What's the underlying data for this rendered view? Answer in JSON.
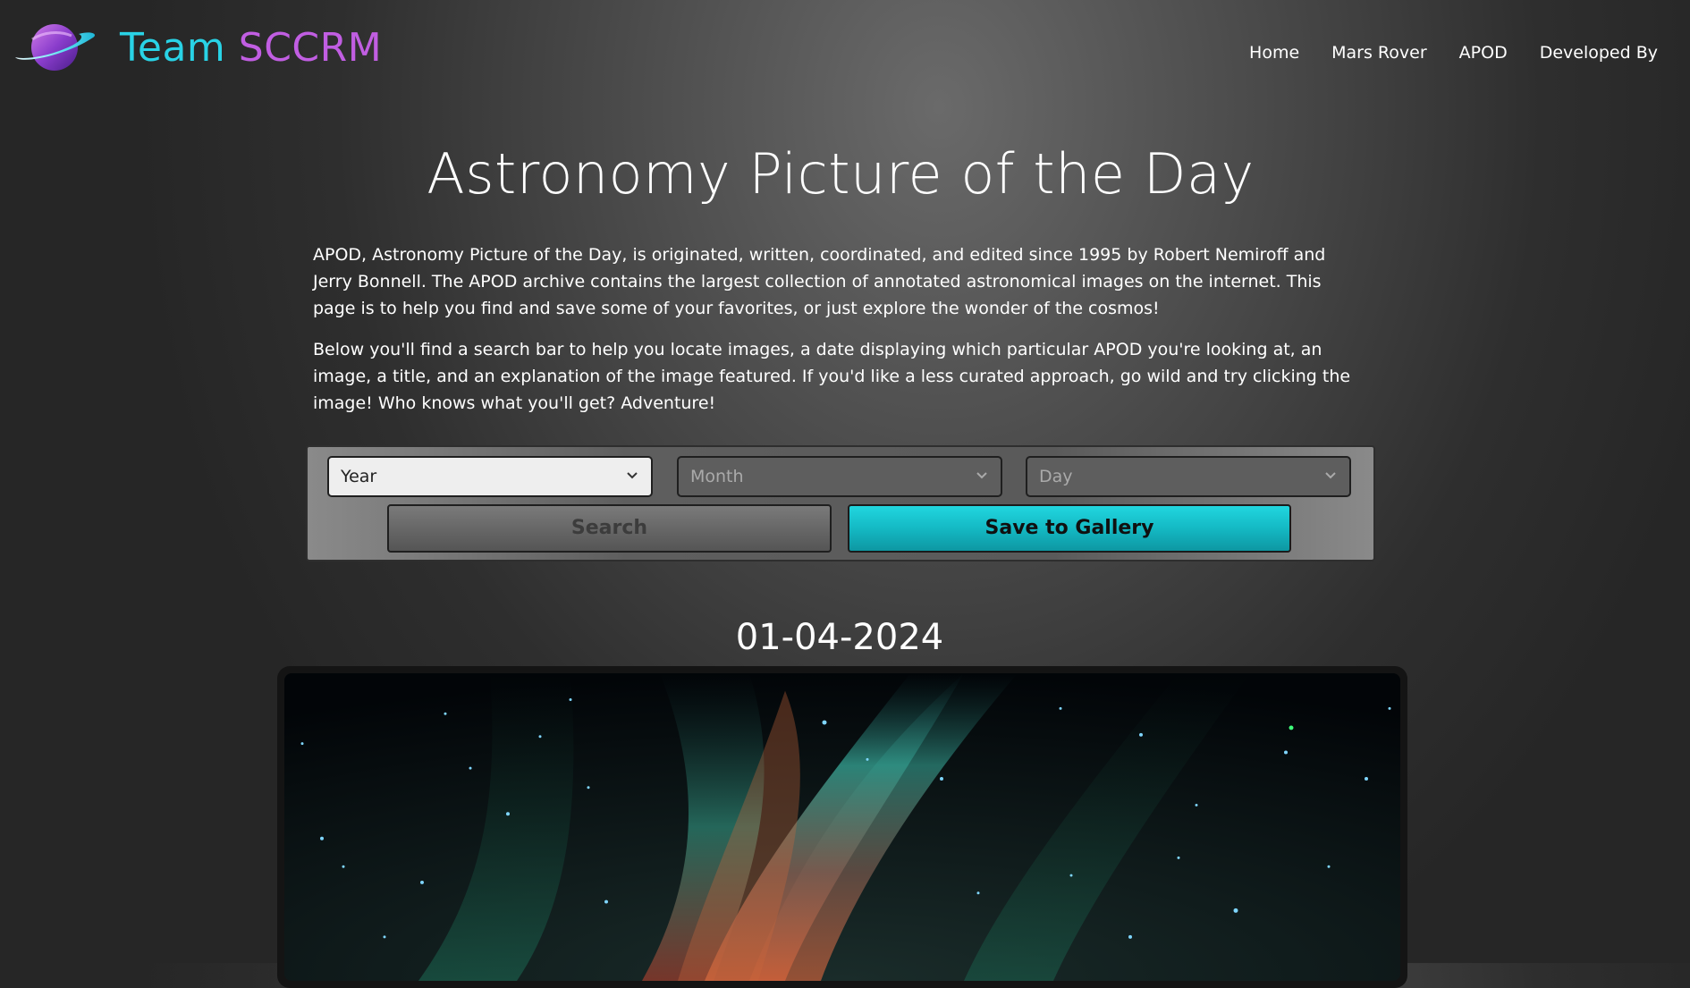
{
  "brand": {
    "name_part1": "Team ",
    "name_part2": "SCCRM",
    "color_team": "#29d3e6",
    "color_sccrm": "#c15ee2",
    "logo_icon": "planet-icon"
  },
  "nav": {
    "items": [
      {
        "label": "Home"
      },
      {
        "label": "Mars Rover"
      },
      {
        "label": "APOD"
      },
      {
        "label": "Developed By"
      }
    ]
  },
  "main": {
    "title": "Astronomy Picture of the Day",
    "paragraph1": "APOD, Astronomy Picture of the Day, is originated, written, coordinated, and edited since 1995 by Robert Nemiroff and Jerry Bonnell. The APOD archive contains the largest collection of annotated astronomical images on the internet. This page is to help you find and save some of your favorites, or just explore the wonder of the cosmos!",
    "paragraph2": "Below you'll find a search bar to help you locate images, a date displaying which particular APOD you're looking at, an image, a title, and an explanation of the image featured. If you'd like a less curated approach, go wild and try clicking the image! Who knows what you'll get? Adventure!"
  },
  "search": {
    "year_placeholder": "Year",
    "month_placeholder": "Month",
    "day_placeholder": "Day",
    "search_label": "Search",
    "save_label": "Save to Gallery",
    "accent_color": "#17c0cb"
  },
  "apod": {
    "date": "01-04-2024",
    "image_icon": "nebula-image"
  }
}
